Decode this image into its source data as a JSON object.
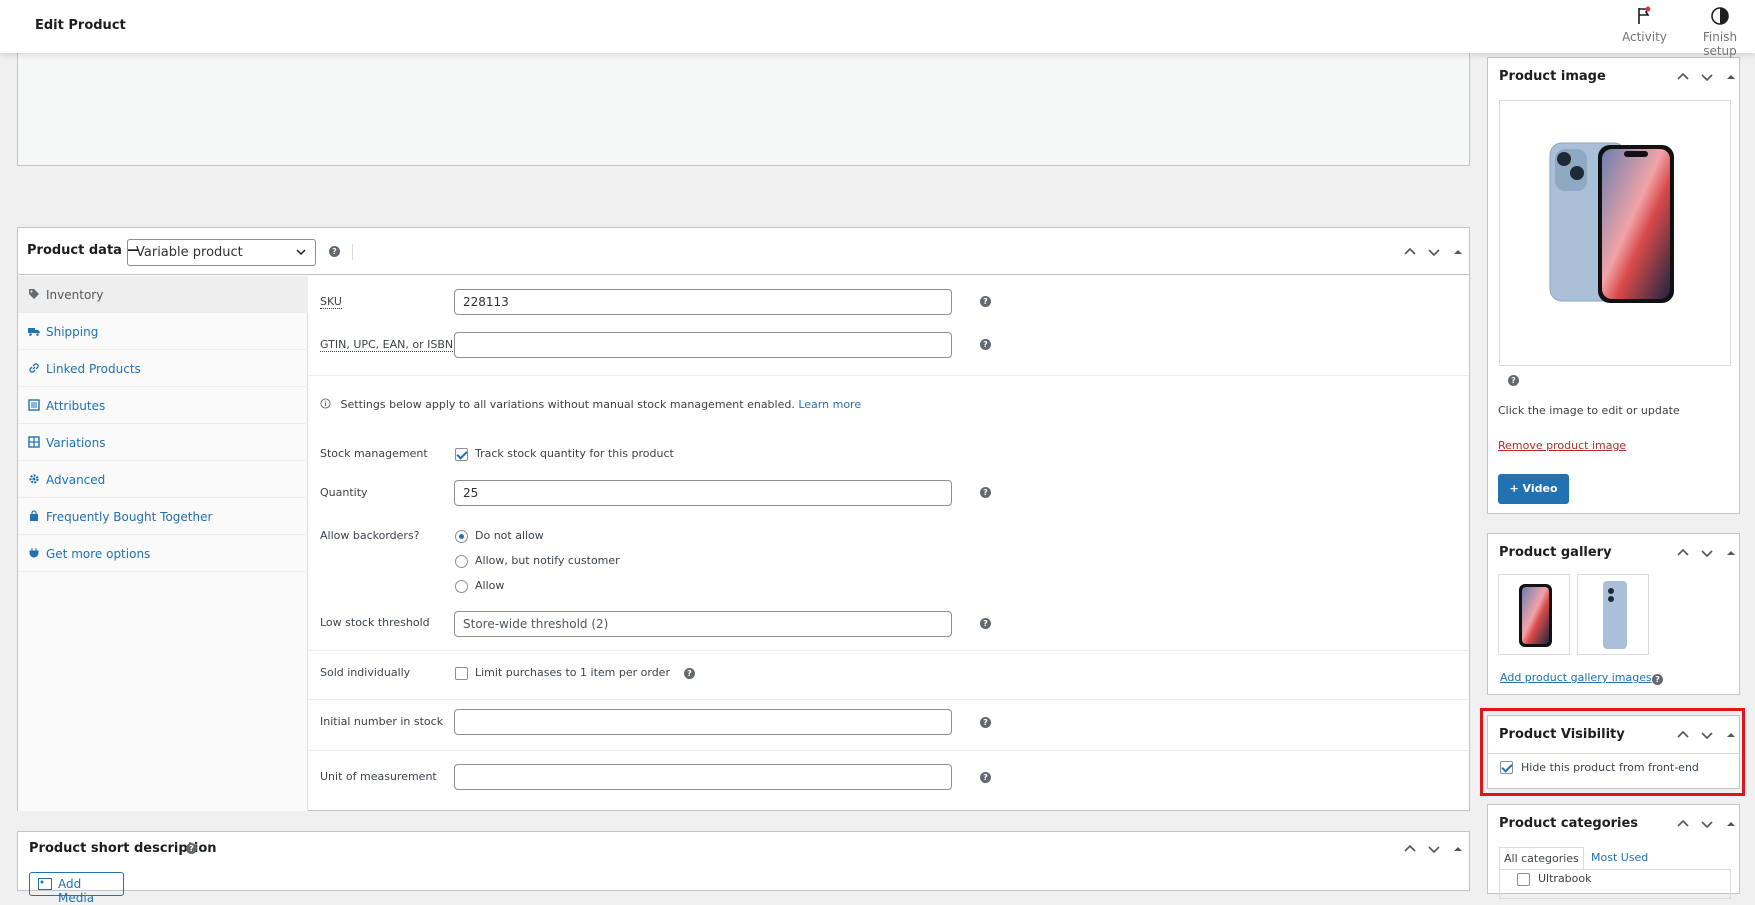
{
  "header": {
    "title": "Edit Product",
    "activity_label": "Activity",
    "finish_setup_label": "Finish setup"
  },
  "product_data": {
    "title": "Product data —",
    "type_selected": "Variable product",
    "tabs": [
      {
        "label": "Inventory",
        "icon": "tag-icon",
        "active": true
      },
      {
        "label": "Shipping",
        "icon": "truck-icon"
      },
      {
        "label": "Linked Products",
        "icon": "link-icon"
      },
      {
        "label": "Attributes",
        "icon": "list-icon"
      },
      {
        "label": "Variations",
        "icon": "grid-icon"
      },
      {
        "label": "Advanced",
        "icon": "gear-icon"
      },
      {
        "label": "Frequently Bought Together",
        "icon": "bag-icon"
      },
      {
        "label": "Get more options",
        "icon": "plugin-icon"
      }
    ],
    "inventory": {
      "sku_label": "SKU",
      "sku_value": "228113",
      "gtin_label": "GTIN, UPC, EAN, or ISBN",
      "gtin_value": "",
      "note_text": "Settings below apply to all variations without manual stock management enabled.",
      "note_link": "Learn more",
      "stock_mgmt_label": "Stock management",
      "stock_mgmt_option": "Track stock quantity for this product",
      "stock_mgmt_checked": true,
      "quantity_label": "Quantity",
      "quantity_value": "25",
      "backorders_label": "Allow backorders?",
      "backorder_options": [
        "Do not allow",
        "Allow, but notify customer",
        "Allow"
      ],
      "backorder_selected": "Do not allow",
      "low_stock_label": "Low stock threshold",
      "low_stock_placeholder": "Store-wide threshold (2)",
      "sold_individually_label": "Sold individually",
      "sold_individually_option": "Limit purchases to 1 item per order",
      "initial_stock_label": "Initial number in stock",
      "initial_stock_value": "",
      "unit_label": "Unit of measurement",
      "unit_value": ""
    }
  },
  "short_description": {
    "title": "Product short description",
    "add_media_label": "Add Media"
  },
  "sidebar": {
    "product_image": {
      "title": "Product image",
      "edit_hint": "Click the image to edit or update",
      "remove_link": "Remove product image",
      "video_button": "+ Video"
    },
    "product_gallery": {
      "title": "Product gallery",
      "add_link": "Add product gallery images"
    },
    "product_visibility": {
      "title": "Product Visibility",
      "hide_label": "Hide this product from front-end",
      "hide_checked": true
    },
    "product_categories": {
      "title": "Product categories",
      "tab_all": "All categories",
      "tab_most_used": "Most Used",
      "first_item": "Ultrabook"
    }
  },
  "colors": {
    "accent": "#2271b1",
    "highlight": "#e0151b",
    "danger_link": "#b32d2e"
  }
}
